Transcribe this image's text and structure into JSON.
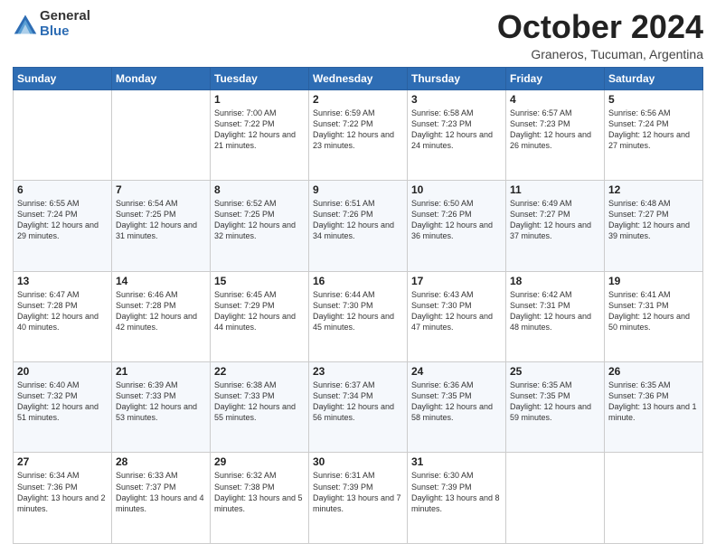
{
  "logo": {
    "general": "General",
    "blue": "Blue"
  },
  "title": "October 2024",
  "subtitle": "Graneros, Tucuman, Argentina",
  "days_of_week": [
    "Sunday",
    "Monday",
    "Tuesday",
    "Wednesday",
    "Thursday",
    "Friday",
    "Saturday"
  ],
  "weeks": [
    [
      {
        "day": "",
        "info": ""
      },
      {
        "day": "",
        "info": ""
      },
      {
        "day": "1",
        "info": "Sunrise: 7:00 AM\nSunset: 7:22 PM\nDaylight: 12 hours and 21 minutes."
      },
      {
        "day": "2",
        "info": "Sunrise: 6:59 AM\nSunset: 7:22 PM\nDaylight: 12 hours and 23 minutes."
      },
      {
        "day": "3",
        "info": "Sunrise: 6:58 AM\nSunset: 7:23 PM\nDaylight: 12 hours and 24 minutes."
      },
      {
        "day": "4",
        "info": "Sunrise: 6:57 AM\nSunset: 7:23 PM\nDaylight: 12 hours and 26 minutes."
      },
      {
        "day": "5",
        "info": "Sunrise: 6:56 AM\nSunset: 7:24 PM\nDaylight: 12 hours and 27 minutes."
      }
    ],
    [
      {
        "day": "6",
        "info": "Sunrise: 6:55 AM\nSunset: 7:24 PM\nDaylight: 12 hours and 29 minutes."
      },
      {
        "day": "7",
        "info": "Sunrise: 6:54 AM\nSunset: 7:25 PM\nDaylight: 12 hours and 31 minutes."
      },
      {
        "day": "8",
        "info": "Sunrise: 6:52 AM\nSunset: 7:25 PM\nDaylight: 12 hours and 32 minutes."
      },
      {
        "day": "9",
        "info": "Sunrise: 6:51 AM\nSunset: 7:26 PM\nDaylight: 12 hours and 34 minutes."
      },
      {
        "day": "10",
        "info": "Sunrise: 6:50 AM\nSunset: 7:26 PM\nDaylight: 12 hours and 36 minutes."
      },
      {
        "day": "11",
        "info": "Sunrise: 6:49 AM\nSunset: 7:27 PM\nDaylight: 12 hours and 37 minutes."
      },
      {
        "day": "12",
        "info": "Sunrise: 6:48 AM\nSunset: 7:27 PM\nDaylight: 12 hours and 39 minutes."
      }
    ],
    [
      {
        "day": "13",
        "info": "Sunrise: 6:47 AM\nSunset: 7:28 PM\nDaylight: 12 hours and 40 minutes."
      },
      {
        "day": "14",
        "info": "Sunrise: 6:46 AM\nSunset: 7:28 PM\nDaylight: 12 hours and 42 minutes."
      },
      {
        "day": "15",
        "info": "Sunrise: 6:45 AM\nSunset: 7:29 PM\nDaylight: 12 hours and 44 minutes."
      },
      {
        "day": "16",
        "info": "Sunrise: 6:44 AM\nSunset: 7:30 PM\nDaylight: 12 hours and 45 minutes."
      },
      {
        "day": "17",
        "info": "Sunrise: 6:43 AM\nSunset: 7:30 PM\nDaylight: 12 hours and 47 minutes."
      },
      {
        "day": "18",
        "info": "Sunrise: 6:42 AM\nSunset: 7:31 PM\nDaylight: 12 hours and 48 minutes."
      },
      {
        "day": "19",
        "info": "Sunrise: 6:41 AM\nSunset: 7:31 PM\nDaylight: 12 hours and 50 minutes."
      }
    ],
    [
      {
        "day": "20",
        "info": "Sunrise: 6:40 AM\nSunset: 7:32 PM\nDaylight: 12 hours and 51 minutes."
      },
      {
        "day": "21",
        "info": "Sunrise: 6:39 AM\nSunset: 7:33 PM\nDaylight: 12 hours and 53 minutes."
      },
      {
        "day": "22",
        "info": "Sunrise: 6:38 AM\nSunset: 7:33 PM\nDaylight: 12 hours and 55 minutes."
      },
      {
        "day": "23",
        "info": "Sunrise: 6:37 AM\nSunset: 7:34 PM\nDaylight: 12 hours and 56 minutes."
      },
      {
        "day": "24",
        "info": "Sunrise: 6:36 AM\nSunset: 7:35 PM\nDaylight: 12 hours and 58 minutes."
      },
      {
        "day": "25",
        "info": "Sunrise: 6:35 AM\nSunset: 7:35 PM\nDaylight: 12 hours and 59 minutes."
      },
      {
        "day": "26",
        "info": "Sunrise: 6:35 AM\nSunset: 7:36 PM\nDaylight: 13 hours and 1 minute."
      }
    ],
    [
      {
        "day": "27",
        "info": "Sunrise: 6:34 AM\nSunset: 7:36 PM\nDaylight: 13 hours and 2 minutes."
      },
      {
        "day": "28",
        "info": "Sunrise: 6:33 AM\nSunset: 7:37 PM\nDaylight: 13 hours and 4 minutes."
      },
      {
        "day": "29",
        "info": "Sunrise: 6:32 AM\nSunset: 7:38 PM\nDaylight: 13 hours and 5 minutes."
      },
      {
        "day": "30",
        "info": "Sunrise: 6:31 AM\nSunset: 7:39 PM\nDaylight: 13 hours and 7 minutes."
      },
      {
        "day": "31",
        "info": "Sunrise: 6:30 AM\nSunset: 7:39 PM\nDaylight: 13 hours and 8 minutes."
      },
      {
        "day": "",
        "info": ""
      },
      {
        "day": "",
        "info": ""
      }
    ]
  ]
}
